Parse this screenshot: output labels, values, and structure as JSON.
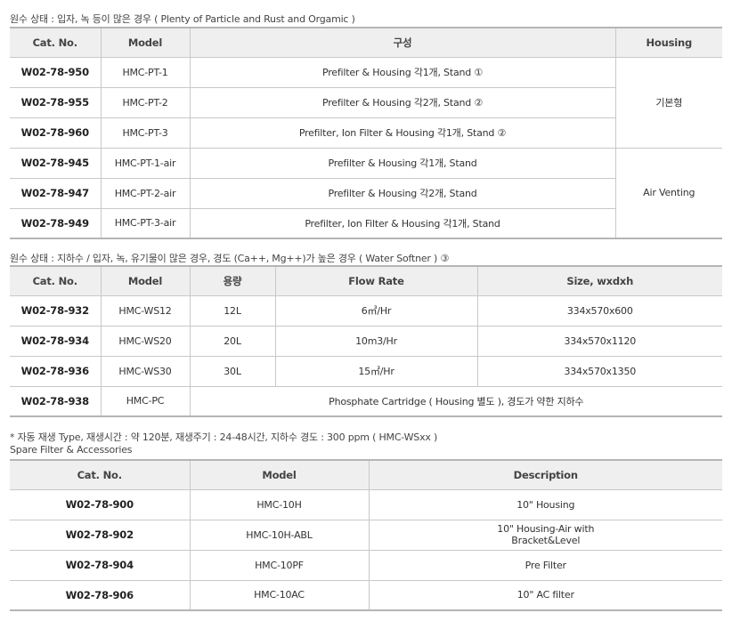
{
  "section1": {
    "caption": "원수 상태 : 입자, 녹 등이 많은 경우 ( Plenty of Particle and Rust and Orgamic )",
    "headers": [
      "Cat. No.",
      "Model",
      "구성",
      "Housing"
    ],
    "rows": [
      {
        "cat": "W02-78-950",
        "model": "HMC-PT-1",
        "config": "Prefilter & Housing 각1개, Stand ①"
      },
      {
        "cat": "W02-78-955",
        "model": "HMC-PT-2",
        "config": "Prefilter & Housing 각2개, Stand ②"
      },
      {
        "cat": "W02-78-960",
        "model": "HMC-PT-3",
        "config": "Prefilter, Ion Filter & Housing 각1개, Stand ②"
      },
      {
        "cat": "W02-78-945",
        "model": "HMC-PT-1-air",
        "config": "Prefilter & Housing 각1개, Stand"
      },
      {
        "cat": "W02-78-947",
        "model": "HMC-PT-2-air",
        "config": "Prefilter & Housing 각2개, Stand"
      },
      {
        "cat": "W02-78-949",
        "model": "HMC-PT-3-air",
        "config": "Prefilter, Ion Filter & Housing 각1개, Stand"
      }
    ],
    "housing_groups": [
      "기본형",
      "Air Venting"
    ]
  },
  "section2": {
    "caption": "원수 상태 : 지하수 / 입자, 녹, 유기물이 많은 경우, 경도 (Ca++, Mg++)가 높은 경우 ( Water Softner ) ③",
    "headers": [
      "Cat. No.",
      "Model",
      "용량",
      "Flow Rate",
      "Size, wxdxh"
    ],
    "rows": [
      {
        "cat": "W02-78-932",
        "model": "HMC-WS12",
        "capacity": "12L",
        "flow": "6㎥/Hr",
        "size": "334x570x600"
      },
      {
        "cat": "W02-78-934",
        "model": "HMC-WS20",
        "capacity": "20L",
        "flow": "10m3/Hr",
        "size": "334x570x1120"
      },
      {
        "cat": "W02-78-936",
        "model": "HMC-WS30",
        "capacity": "30L",
        "flow": "15㎥/Hr",
        "size": "334x570x1350"
      }
    ],
    "last_row": {
      "cat": "W02-78-938",
      "model": "HMC-PC",
      "desc": "Phosphate Cartridge ( Housing 별도 ), 경도가 약한 지하수"
    },
    "note": "* 자동 재생 Type, 재생시간 : 약 120분, 재생주기 : 24-48시간, 지하수 경도 : 300 ppm ( HMC-WSxx )"
  },
  "section3": {
    "caption": "Spare Filter & Accessories",
    "headers": [
      "Cat. No.",
      "Model",
      "Description"
    ],
    "rows": [
      {
        "cat": "W02-78-900",
        "model": "HMC-10H",
        "desc": "10\" Housing"
      },
      {
        "cat": "W02-78-902",
        "model": "HMC-10H-ABL",
        "desc_line1": "10\" Housing-Air with",
        "desc_line2": "Bracket&Level"
      },
      {
        "cat": "W02-78-904",
        "model": "HMC-10PF",
        "desc": "Pre Filter"
      },
      {
        "cat": "W02-78-906",
        "model": "HMC-10AC",
        "desc": "10\" AC filter"
      }
    ]
  }
}
